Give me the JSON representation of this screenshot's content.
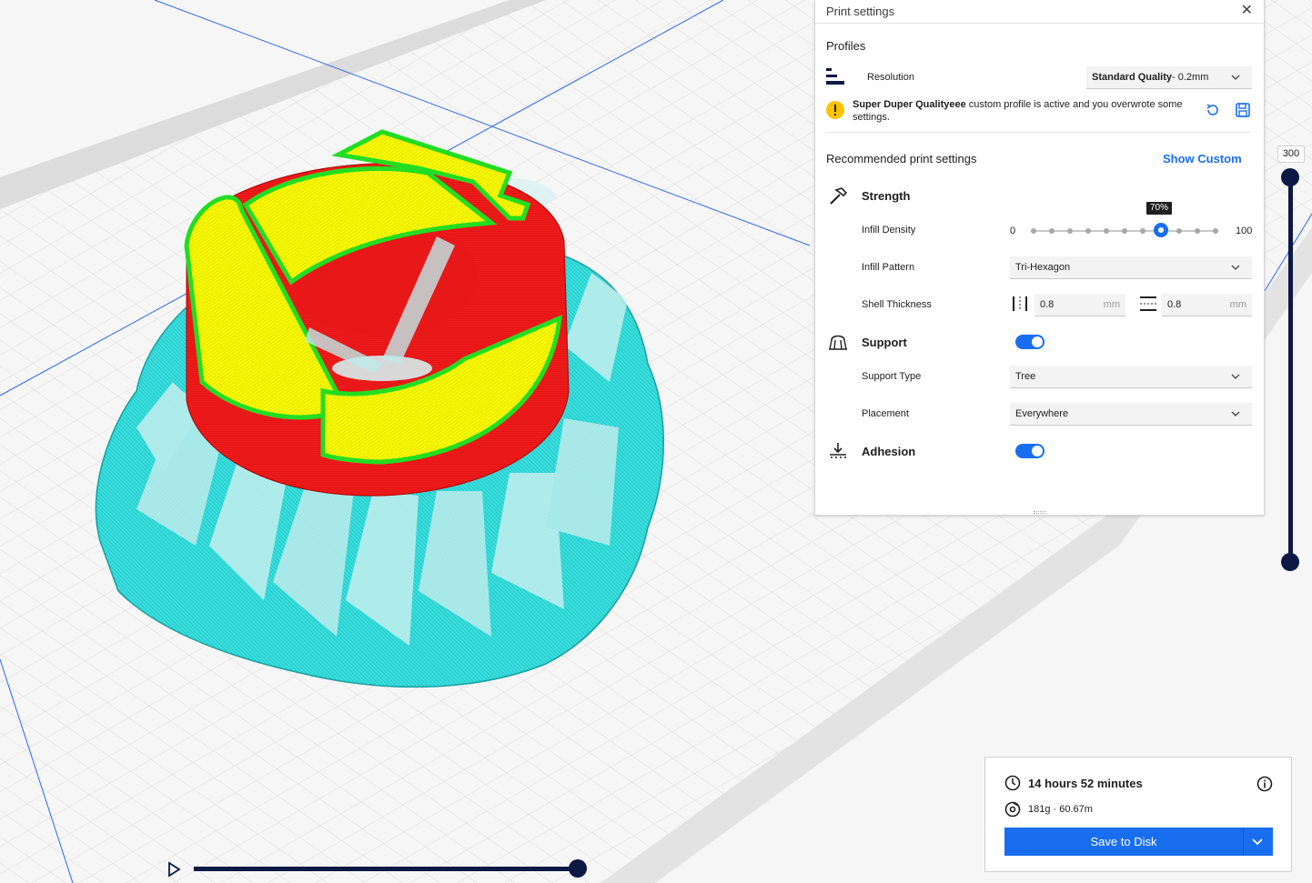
{
  "panel": {
    "title": "Print settings",
    "profiles_heading": "Profiles",
    "resolution_label": "Resolution",
    "resolution_value_bold": "Standard Quality",
    "resolution_value_rest": " - 0.2mm",
    "warning_bold": "Super Duper Qualityeee",
    "warning_rest": " custom profile is active and you overwrote some settings.",
    "recommended_heading": "Recommended print settings",
    "show_custom": "Show Custom",
    "strength": {
      "label": "Strength",
      "infill_density_label": "Infill Density",
      "infill_min": "0",
      "infill_max": "100",
      "infill_tooltip": "70%",
      "infill_value": 70,
      "infill_pattern_label": "Infill Pattern",
      "infill_pattern_value": "Tri-Hexagon",
      "shell_thickness_label": "Shell Thickness",
      "wall_value": "0.8",
      "top_bottom_value": "0.8",
      "unit": "mm"
    },
    "support": {
      "label": "Support",
      "enabled": true,
      "type_label": "Support Type",
      "type_value": "Tree",
      "placement_label": "Placement",
      "placement_value": "Everywhere"
    },
    "adhesion": {
      "label": "Adhesion",
      "enabled": true
    }
  },
  "layer_slider": {
    "current_layer": "300"
  },
  "output": {
    "print_time": "14 hours 52 minutes",
    "material": "181g · 60.67m",
    "save_label": "Save to Disk"
  },
  "colors": {
    "accent": "#196ef0",
    "slider_dark": "#0c1945",
    "shell_red": "#ee1c1c",
    "skin_yellow": "#ffff00",
    "outer_wall_green": "#30e830",
    "support_cyan": "#35d7d7",
    "warning_yellow": "#fec200"
  }
}
